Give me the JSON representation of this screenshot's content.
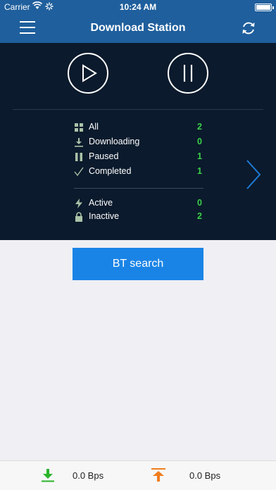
{
  "status_bar": {
    "carrier": "Carrier",
    "time": "10:24 AM"
  },
  "nav": {
    "title": "Download Station",
    "menu_icon": "hamburger-menu-icon",
    "refresh_icon": "refresh-icon"
  },
  "controls": {
    "play_icon": "play-icon",
    "pause_icon": "pause-icon"
  },
  "stats": [
    {
      "label": "All",
      "count": "2",
      "icon": "grid-icon"
    },
    {
      "label": "Downloading",
      "count": "0",
      "icon": "download-icon"
    },
    {
      "label": "Paused",
      "count": "1",
      "icon": "pause-small-icon"
    },
    {
      "label": "Completed",
      "count": "1",
      "icon": "checkmark-icon"
    },
    {
      "label": "Active",
      "count": "0",
      "icon": "lightning-icon"
    },
    {
      "label": "Inactive",
      "count": "2",
      "icon": "lock-icon"
    }
  ],
  "bt_search": {
    "label": "BT search"
  },
  "bottom": {
    "download_speed": "0.0 Bps",
    "upload_speed": "0.0 Bps"
  },
  "colors": {
    "navbar": "#1f5f9d",
    "panel": "#0b1a2c",
    "count_green": "#3bd14a",
    "button_blue": "#1a84e6",
    "download_green": "#2bb52b",
    "upload_orange": "#f07d1e"
  }
}
